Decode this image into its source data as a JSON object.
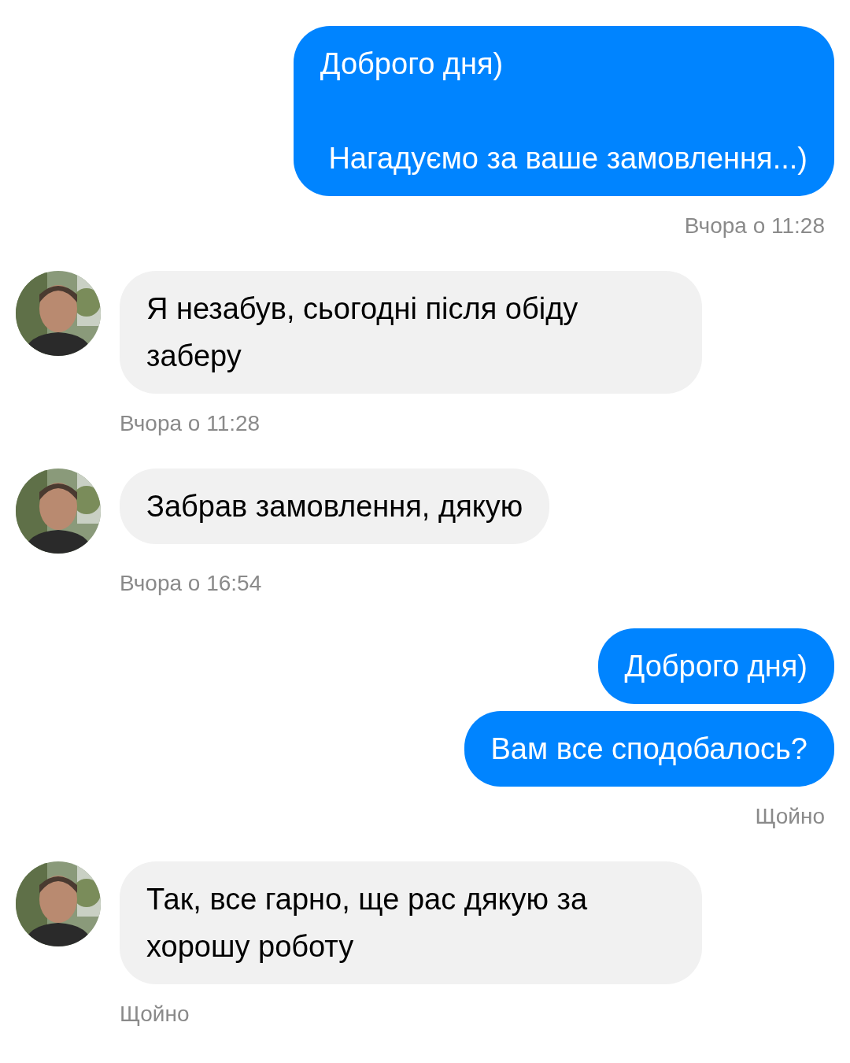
{
  "groups": [
    {
      "kind": "outgoing",
      "messages": [
        "Доброго дня)\n\n Нагадуємо за ваше замовлення...)"
      ],
      "time": "Вчора о 11:28"
    },
    {
      "kind": "incoming",
      "messages": [
        "Я незабув, сьогодні після обіду заберу"
      ],
      "time": "Вчора о 11:28"
    },
    {
      "kind": "incoming",
      "messages": [
        "Забрав замовлення, дякую"
      ],
      "time": "Вчора о 16:54"
    },
    {
      "kind": "outgoing",
      "messages": [
        "Доброго дня)",
        "Вам все сподобалось?"
      ],
      "time": "Щойно"
    },
    {
      "kind": "incoming",
      "messages": [
        "Так, все гарно, ще рас дякую за хорошу роботу"
      ],
      "time": "Щойно"
    }
  ]
}
